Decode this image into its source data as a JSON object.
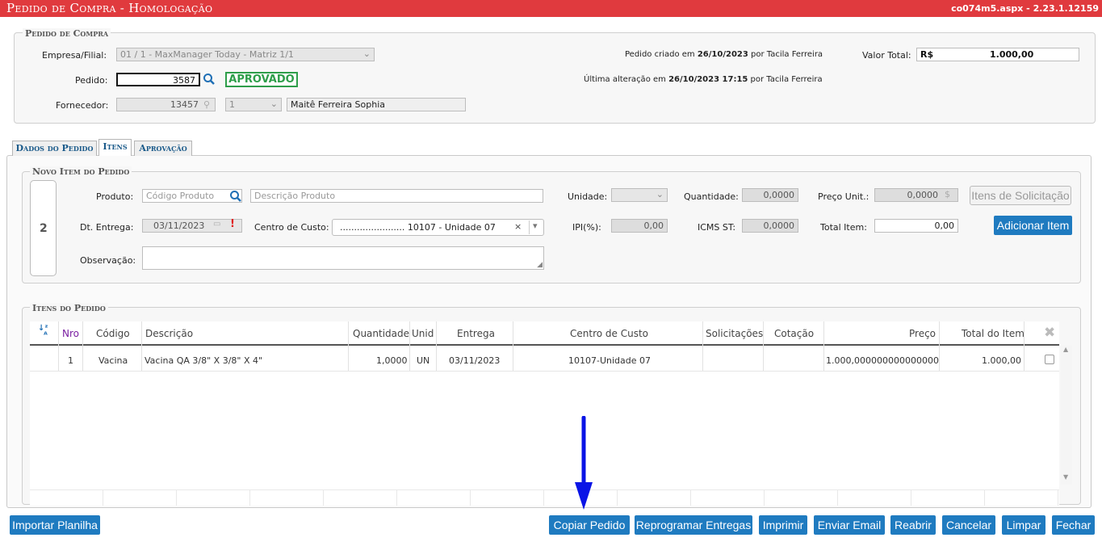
{
  "header": {
    "title": "Pedido de Compra  - Homologação",
    "page_id": "co074m5.aspx - 2.23.1.12159"
  },
  "pedido_compra": {
    "legend": "Pedido de Compra",
    "empresa_label": "Empresa/Filial:",
    "empresa_value": "01 / 1 - MaxManager Today - Matriz 1/1",
    "pedido_label": "Pedido:",
    "pedido_value": "3587",
    "status": "APROVADO",
    "fornecedor_label": "Fornecedor:",
    "fornecedor_code": "13457",
    "fornecedor_seq": "1",
    "fornecedor_name": "Maitê Ferreira Sophia",
    "criado_prefix": "Pedido criado em",
    "criado_date": "26/10/2023",
    "criado_suffix": "por Tacila Ferreira",
    "alteracao_prefix": "Última alteração em",
    "alteracao_date": "26/10/2023 17:15",
    "alteracao_suffix": "por Tacila Ferreira",
    "valor_total_label": "Valor Total:",
    "valor_currency": "R$",
    "valor_total": "1.000,00"
  },
  "tabs": [
    {
      "label": "Dados do Pedido",
      "active": false
    },
    {
      "label": "Itens",
      "active": true
    },
    {
      "label": "Aprovação",
      "active": false
    }
  ],
  "novo_item": {
    "legend": "Novo Item do Pedido",
    "item_number": "2",
    "produto_label": "Produto:",
    "produto_placeholder": "Código Produto",
    "descricao_placeholder": "Descrição Produto",
    "unidade_label": "Unidade:",
    "quantidade_label": "Quantidade:",
    "quantidade_value": "0,0000",
    "preco_label": "Preço Unit.:",
    "preco_value": "0,0000",
    "itens_solicitacao_label": "Itens de Solicitação",
    "dt_entrega_label": "Dt. Entrega:",
    "dt_entrega_value": "03/11/2023",
    "centro_custo_label": "Centro de Custo:",
    "centro_custo_value": "....................... 10107 - Unidade 07",
    "ipi_label": "IPI(%):",
    "ipi_value": "0,00",
    "icms_label": "ICMS ST:",
    "icms_value": "0,0000",
    "total_item_label": "Total Item:",
    "total_item_value": "0,00",
    "adicionar_label": "Adicionar Item",
    "observacao_label": "Observação:"
  },
  "itens_pedido": {
    "legend": "Itens do Pedido",
    "columns": [
      "Nro",
      "Código",
      "Descrição",
      "Quantidade",
      "Unid",
      "Entrega",
      "Centro de Custo",
      "Solicitações",
      "Cotação",
      "Preço",
      "Total do Item"
    ],
    "rows": [
      {
        "nro": "1",
        "codigo": "Vacina",
        "descricao": "Vacina QA 3/8\" X 3/8\" X 4\"",
        "quantidade": "1,0000",
        "unid": "UN",
        "entrega": "03/11/2023",
        "centro": "10107-Unidade 07",
        "solicitacoes": "",
        "cotacao": "",
        "preco": "1.000,000000000000000",
        "total": "1.000,00"
      }
    ]
  },
  "footer": {
    "importar": "Importar Planilha",
    "copiar": "Copiar Pedido",
    "reprogramar": "Reprogramar Entregas",
    "imprimir": "Imprimir",
    "enviar_email": "Enviar Email",
    "reabrir": "Reabrir",
    "cancelar": "Cancelar",
    "limpar": "Limpar",
    "fechar": "Fechar"
  },
  "colors": {
    "header_red": "#e03a3e",
    "button_blue": "#1f7bc0",
    "status_green": "#2e9e4a",
    "arrow_blue": "#0a14e6"
  }
}
